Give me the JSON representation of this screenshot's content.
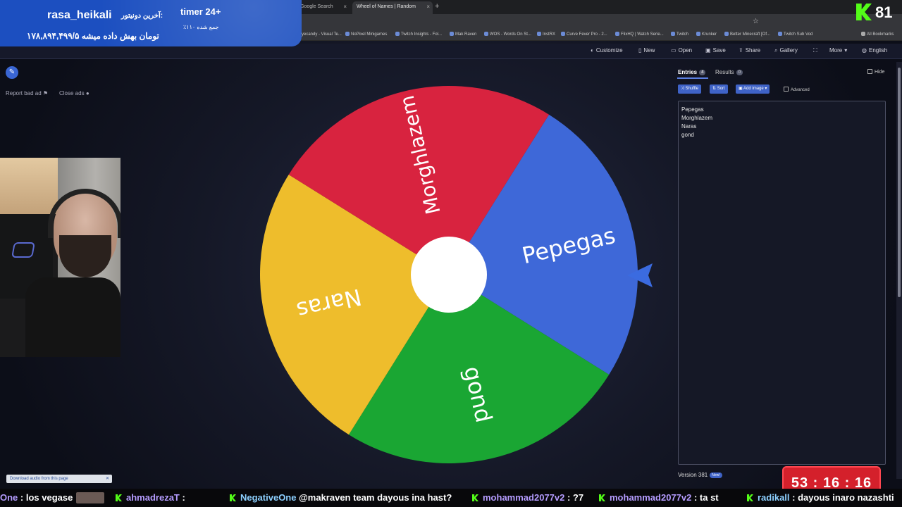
{
  "browser": {
    "tabs": [
      {
        "title": "Google Search"
      },
      {
        "title": "Wheel of Names | Random"
      }
    ],
    "new_tab_symbol": "+",
    "close_symbol": "×",
    "bookmarks": [
      "Eyecandy - Visual Te...",
      "NoPixel Minigames",
      "Twitch Insights - Fol...",
      "Mak Raven",
      "WOS - Words On St...",
      "InstRX",
      "Curve Fever Pro - 2...",
      "FlixHQ | Watch Serie...",
      "Twitch",
      "Krunker",
      "Better Minecraft [Of...",
      "Twitch Sub Vod",
      "All Bookmarks"
    ]
  },
  "site_toolbar": {
    "items": [
      "Customize",
      "New",
      "Open",
      "Save",
      "Share",
      "Gallery",
      "",
      "More",
      "English"
    ]
  },
  "overlay": {
    "donor_name": "rasa_heikali",
    "donor_label": "آخرین دونیتور:",
    "donor_amount": "۱۷۸,۸۹۴,۴۹۹/۵ تومان بهش داده میشه",
    "timer_label": "timer 24+",
    "timer_sub": "٪۱۱۰ جمع شده",
    "viewer_count": "81"
  },
  "left_panel": {
    "report_bad_ad": "Report bad ad",
    "close_ads": "Close ads"
  },
  "wheel": {
    "segments": [
      {
        "label": "Pepegas",
        "color": "#3e68d8"
      },
      {
        "label": "gond",
        "color": "#1aa633"
      },
      {
        "label": "Naras",
        "color": "#eebd2c"
      },
      {
        "label": "Morghlazem",
        "color": "#d8233f"
      }
    ],
    "pointer_color": "#3b6be0",
    "hub_color": "#ffffff"
  },
  "entries_panel": {
    "tab_entries": "Entries",
    "tab_entries_count": "4",
    "tab_results": "Results",
    "tab_results_count": "0",
    "hide_label": "Hide",
    "shuffle_label": "Shuffle",
    "sort_label": "Sort",
    "add_image_label": "Add image",
    "advanced_label": "Advanced",
    "entries": [
      "Pepegas",
      "Morghlazem",
      "Naras",
      "gond"
    ],
    "version_label": "Version 381",
    "new_badge": "New!"
  },
  "download_audio": "Download audio from this page",
  "countdown": "53 : 16 : 16",
  "chat_ticker": [
    {
      "user": "One",
      "message": ": los vegase"
    },
    {
      "user": "ahmadrezaT",
      "message": ":"
    },
    {
      "user": "NegativeOne",
      "message": "@makraven team dayous ina hast?"
    },
    {
      "user": "mohammad2077v2",
      "message": ": ?7"
    },
    {
      "user": "mohammad2077v2",
      "message": ": ta st"
    },
    {
      "user": "radikall",
      "message": ": dayous inaro nazashti"
    }
  ]
}
